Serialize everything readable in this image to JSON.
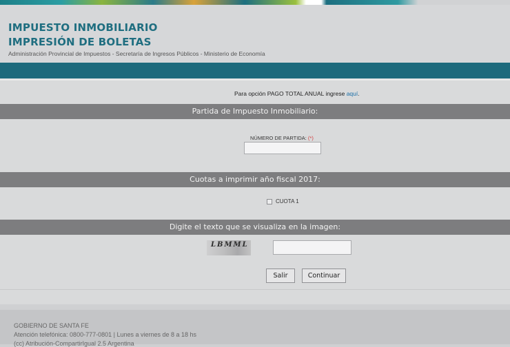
{
  "header": {
    "title_line1": "IMPUESTO INMOBILIARIO",
    "title_line2": "IMPRESIÓN DE BOLETAS",
    "subtitle": "Administración Provincial de Impuestos - Secretaría de Ingresos Públicos - Ministerio de Economía"
  },
  "pago": {
    "text": "Para opción PAGO TOTAL ANUAL ingrese ",
    "link": "aquí",
    "period": "."
  },
  "partida": {
    "section_title": "Partida de Impuesto Inmobiliario:",
    "label": "NÚMERO DE PARTIDA:",
    "required_mark": "(*)",
    "value": ""
  },
  "cuotas": {
    "section_title": "Cuotas a imprimir año fiscal 2017:",
    "items": [
      {
        "label": "CUOTA 1",
        "checked": false
      }
    ]
  },
  "captcha": {
    "section_title": "Digite el texto que se visualiza en la imagen:",
    "image_text": "LBMML",
    "value": ""
  },
  "actions": {
    "salir_label": "Salir",
    "continuar_label": "Continuar"
  },
  "footer": {
    "line1": "GOBIERNO DE SANTA FE",
    "line2": "Atención telefónica: 0800-777-0801 | Lunes a viernes de 8 a 18 hs",
    "line3": "(cc) Atribución-CompartirIgual 2.5 Argentina"
  },
  "colors": {
    "brand_teal": "#1d6a7c",
    "title_color": "#1f6e80",
    "section_bar": "#7d7d7f",
    "link": "#1a6fa8",
    "required": "#d23b3b"
  }
}
